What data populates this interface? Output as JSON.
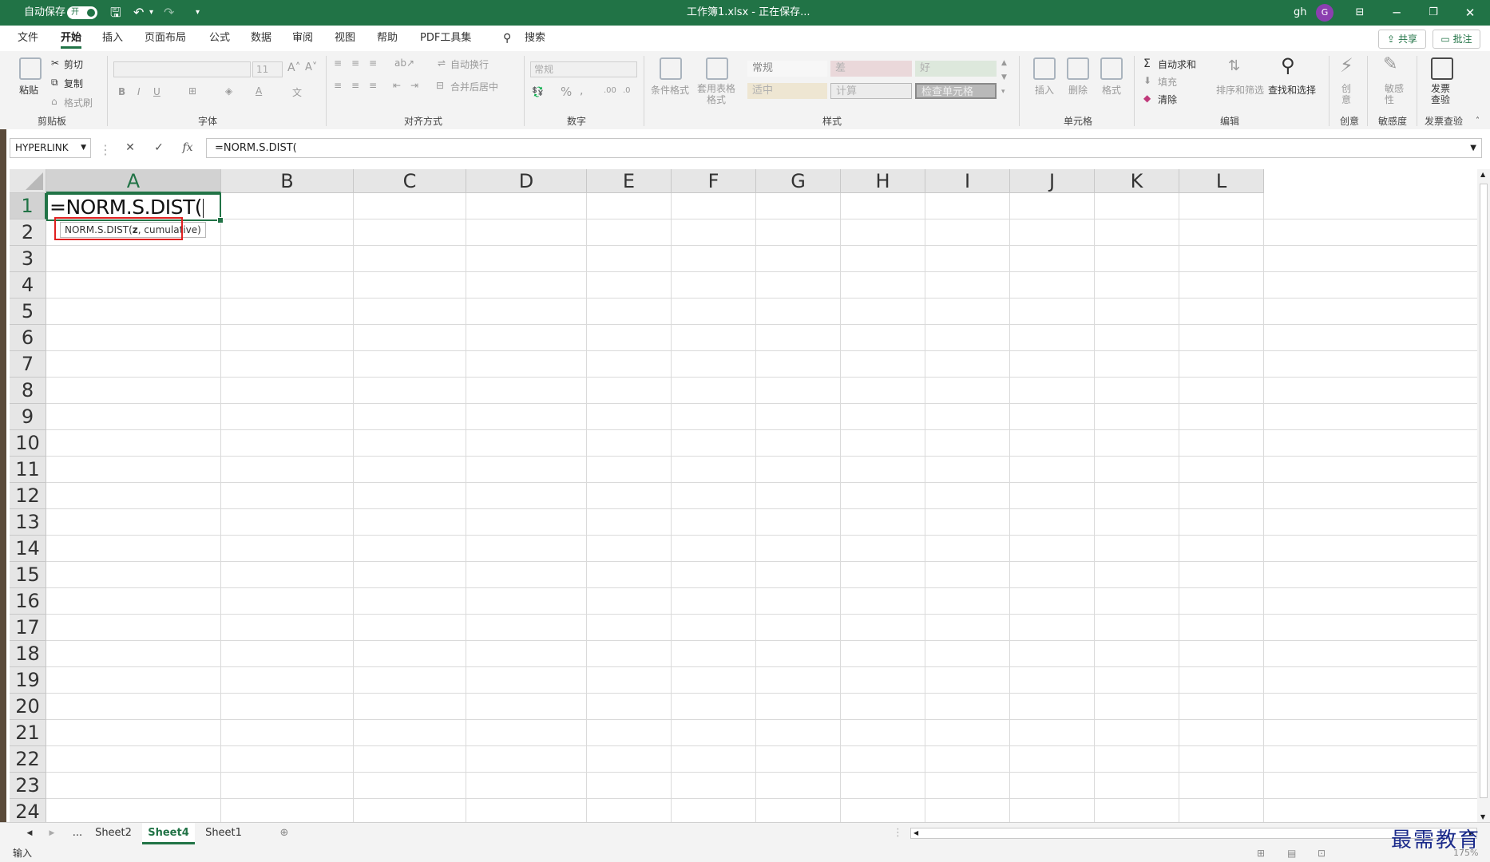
{
  "title_bar": {
    "autosave_label": "自动保存",
    "autosave_state": "开",
    "doc_title": "工作簿1.xlsx - 正在保存...",
    "user_name": "gh",
    "avatar_letter": "G"
  },
  "menu": {
    "items": [
      "文件",
      "开始",
      "插入",
      "页面布局",
      "公式",
      "数据",
      "审阅",
      "视图",
      "帮助",
      "PDF工具集"
    ],
    "active_index": 1,
    "search_label": "搜索",
    "share_label": "共享",
    "comment_label": "批注"
  },
  "ribbon": {
    "clipboard": {
      "paste": "粘贴",
      "cut": "剪切",
      "copy": "复制",
      "format_painter": "格式刷",
      "group": "剪贴板"
    },
    "font": {
      "size": "11",
      "group": "字体"
    },
    "alignment": {
      "wrap": "自动换行",
      "merge": "合并后居中",
      "group": "对齐方式"
    },
    "number": {
      "format": "常规",
      "group": "数字"
    },
    "styles": {
      "conditional": "条件格式",
      "table_format": "套用表格格式",
      "cells": [
        "常规",
        "差",
        "好",
        "适中",
        "计算",
        "检查单元格"
      ],
      "group": "样式"
    },
    "cells_group": {
      "insert": "插入",
      "delete": "删除",
      "format": "格式",
      "group": "单元格"
    },
    "editing": {
      "autosum": "自动求和",
      "fill": "填充",
      "clear": "清除",
      "sort_filter": "排序和筛选",
      "find_select": "查找和选择",
      "group": "编辑"
    },
    "creative": {
      "label": "创意",
      "group": "创意"
    },
    "sensitivity": {
      "label": "敏感性",
      "group": "敏感度"
    },
    "invoice": {
      "label": "发票查验",
      "group": "发票查验"
    }
  },
  "formula_bar": {
    "name_box": "HYPERLINK",
    "fx": "fx",
    "formula": "=NORM.S.DIST("
  },
  "grid": {
    "columns": [
      "A",
      "B",
      "C",
      "D",
      "E",
      "F",
      "G",
      "H",
      "I",
      "J",
      "K",
      "L"
    ],
    "rows": [
      "1",
      "2",
      "3",
      "4",
      "5",
      "6",
      "7",
      "8",
      "9",
      "10",
      "11",
      "12",
      "13",
      "14",
      "15",
      "16",
      "17",
      "18",
      "19",
      "20",
      "21",
      "22",
      "23",
      "24"
    ],
    "active_cell_text": "=NORM.S.DIST(",
    "tooltip_func": "NORM.S.DIST(",
    "tooltip_arg_bold": "z",
    "tooltip_rest": ", cumulative)"
  },
  "sheets": {
    "ellipsis": "...",
    "tabs": [
      "Sheet2",
      "Sheet4",
      "Sheet1"
    ],
    "active_index": 1
  },
  "status": {
    "mode": "输入",
    "zoom": "175%"
  },
  "watermark": "最需教育",
  "colors": {
    "accent": "#217346",
    "highlight_box": "#e02020"
  }
}
